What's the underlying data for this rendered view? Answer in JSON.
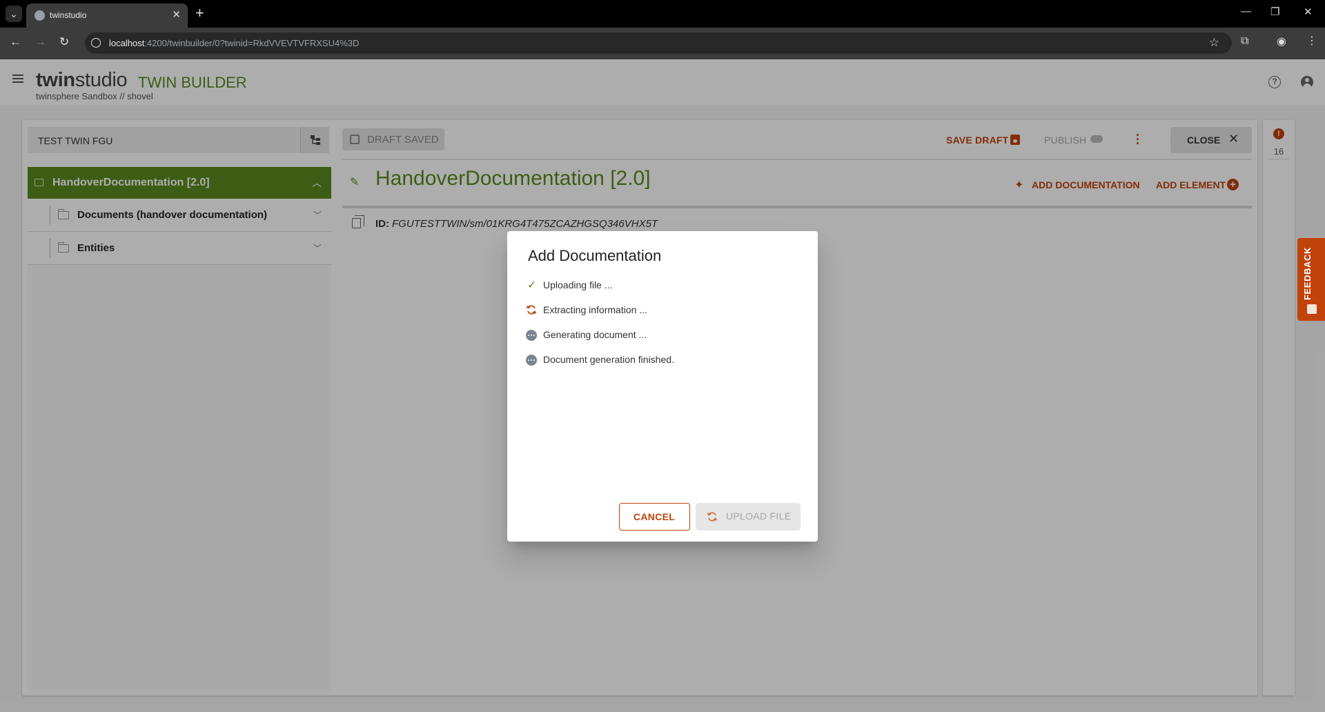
{
  "browser": {
    "tab_title": "twinstudio",
    "url_host": "localhost",
    "url_path": ":4200/twinbuilder/0?twinid=RkdVVEVTVFRXSU4%3D"
  },
  "app": {
    "brand_twin": "twin",
    "brand_studio": "studio",
    "product": "TWIN BUILDER",
    "subtitle": "twinsphere Sandbox // shovel"
  },
  "twin": {
    "name": "TEST TWIN FGU"
  },
  "tree": {
    "root_label": "HandoverDocumentation [2.0]",
    "items": [
      {
        "label": "Documents (handover documentation)"
      },
      {
        "label": "Entities"
      }
    ]
  },
  "toolbar": {
    "draft_status": "DRAFT SAVED",
    "save_draft": "SAVE DRAFT",
    "publish": "PUBLISH",
    "close": "CLOSE"
  },
  "element": {
    "title": "HandoverDocumentation [2.0]",
    "add_documentation": "ADD DOCUMENTATION",
    "add_element": "ADD ELEMENT",
    "id_label": "ID:",
    "id_value": "FGUTESTTWIN/sm/01KRG4T475ZCAZHGSQ346VHX5T"
  },
  "side_panel": {
    "count": "16"
  },
  "feedback": {
    "label": "FEEDBACK"
  },
  "dialog": {
    "title": "Add Documentation",
    "steps": [
      {
        "text": "Uploading file ...",
        "status": "done"
      },
      {
        "text": "Extracting information ...",
        "status": "in-progress"
      },
      {
        "text": "Generating document ...",
        "status": "pending"
      },
      {
        "text": "Document generation finished.",
        "status": "pending"
      }
    ],
    "cancel": "CANCEL",
    "upload": "UPLOAD FILE"
  },
  "colors": {
    "brand_green": "#5a8a1e",
    "accent_orange": "#c0430c"
  }
}
